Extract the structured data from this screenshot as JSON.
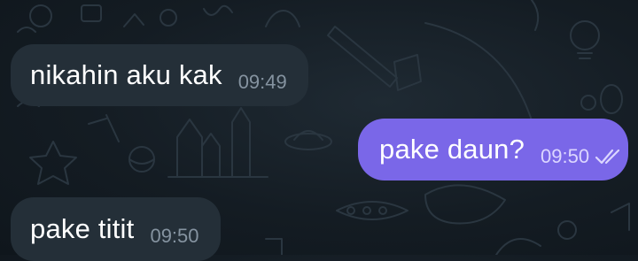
{
  "messages": [
    {
      "direction": "incoming",
      "text": "nikahin aku kak",
      "time": "09:49"
    },
    {
      "direction": "outgoing",
      "text": "pake daun?",
      "time": "09:50",
      "status_icon": "double-check-icon"
    },
    {
      "direction": "incoming",
      "text": "pake titit",
      "time": "09:50"
    }
  ],
  "colors": {
    "background": "#141c23",
    "incoming_bubble": "#242f38",
    "outgoing_bubble": "#7a67e8",
    "incoming_time": "#8593a0",
    "outgoing_time": "#dcd6ff"
  }
}
